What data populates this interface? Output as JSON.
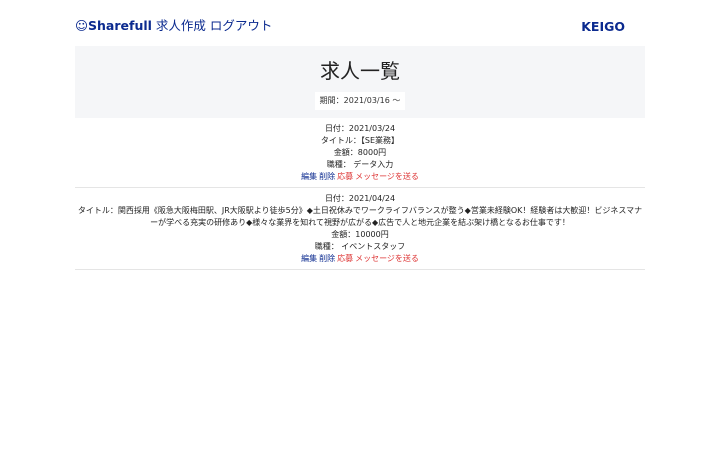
{
  "header": {
    "logo_icon": "☺",
    "app_name": "Sharefull",
    "nav_create": "求人作成",
    "nav_logout": "ログアウト",
    "user_name": "KEIGO",
    "brand_color": "#0b2a8f"
  },
  "hero": {
    "title": "求人一覧",
    "period": "期間：2021/03/16 〜"
  },
  "jobs": [
    {
      "date": "日付：2021/03/24",
      "title": "タイトル：【SE業務】",
      "amount": "金額：8000円",
      "category": "職種： データ入力",
      "edit": "編集",
      "delete": "削除",
      "apply": "応募",
      "message": "メッセージを送る"
    },
    {
      "date": "日付：2021/04/24",
      "title": "タイトル：関西採用《阪急大阪梅田駅、JR大阪駅より徒歩5分》◆土日祝休みでワークライフバランスが整う◆営業未経験OK！経験者は大歓迎！ビジネスマナーが学べる充実の研修あり◆様々な業界を知れて視野が広がる◆広告で人と地元企業を結ぶ架け橋となるお仕事です！",
      "amount": "金額：10000円",
      "category": "職種： イベントスタッフ",
      "edit": "編集",
      "delete": "削除",
      "apply": "応募",
      "message": "メッセージを送る"
    }
  ],
  "colors": {
    "link_blue": "#0b2a8f",
    "action_red": "#dd3333",
    "hero_bg": "#f5f6f8"
  }
}
